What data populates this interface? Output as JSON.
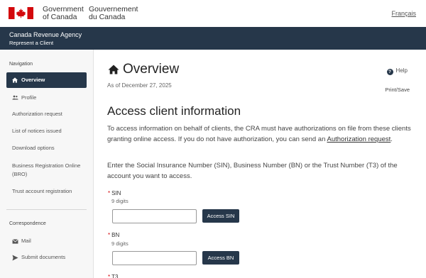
{
  "header": {
    "gov_en_line1": "Government",
    "gov_en_line2": "of Canada",
    "gov_fr_line1": "Gouvernement",
    "gov_fr_line2": "du Canada",
    "language_link": "Français",
    "flag_icon": "canada-flag-icon",
    "flag_color": "#d3080c"
  },
  "agency": {
    "title": "Canada Revenue Agency",
    "subtitle": "Represent a Client",
    "bar_color": "#26374a"
  },
  "sidebar": {
    "nav_heading": "Navigation",
    "items": [
      {
        "label": "Overview",
        "icon": "home-icon",
        "active": true
      },
      {
        "label": "Profile",
        "icon": "people-icon",
        "active": false
      },
      {
        "label": "Authorization request",
        "active": false
      },
      {
        "label": "List of notices issued",
        "active": false
      },
      {
        "label": "Download options",
        "active": false
      },
      {
        "label": "Business Registration Online",
        "label2": "(BRO)",
        "active": false
      },
      {
        "label": "Trust account registration",
        "active": false
      }
    ],
    "correspondence_heading": "Correspondence",
    "correspondence_items": [
      {
        "label": "Mail",
        "icon": "mail-icon"
      },
      {
        "label": "Submit documents",
        "icon": "send-icon"
      }
    ]
  },
  "main": {
    "title": "Overview",
    "help_label": "Help",
    "date": "As of December 27, 2025",
    "print_label": "Print/Save",
    "section_title": "Access client information",
    "para1_part1": "To access information on behalf of clients, the CRA must have authorizations on file from these clients granting online access. If you do not have authorization, you can send an",
    "para1_link": "Authorization request",
    "para1_end": ".",
    "para2": "Enter the Social Insurance Number (SIN), Business Number (BN) or the Trust Number (T3) of the account you want to access.",
    "fields": [
      {
        "label": "SIN",
        "hint": "9 digits",
        "button": "Access SIN",
        "value": ""
      },
      {
        "label": "BN",
        "hint": "9 digits",
        "button": "Access BN",
        "value": ""
      },
      {
        "label": "T3"
      }
    ],
    "required_marker": "*"
  }
}
